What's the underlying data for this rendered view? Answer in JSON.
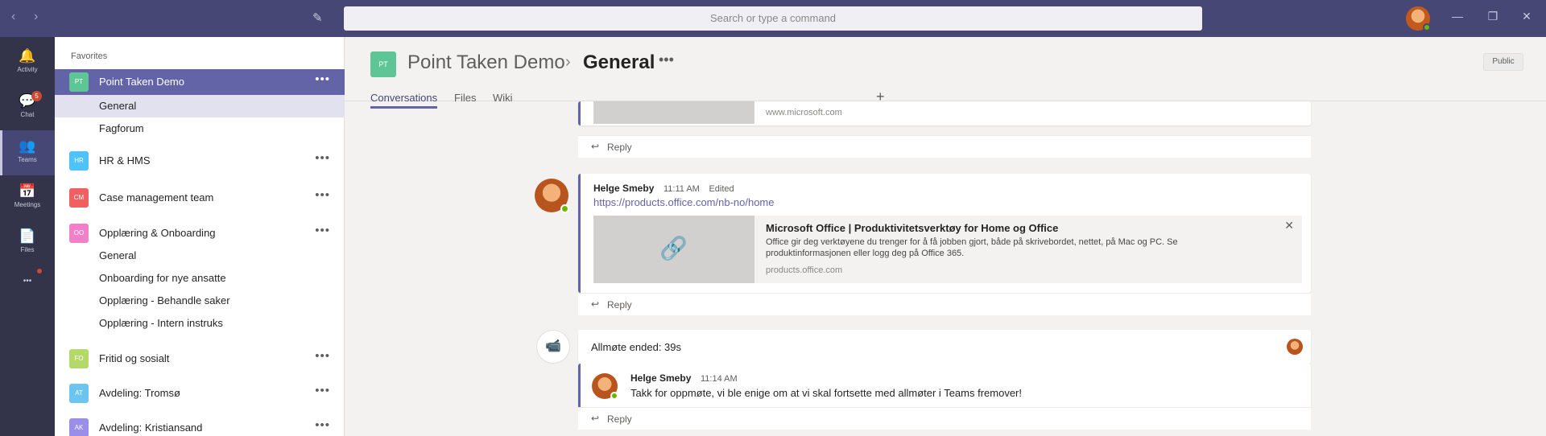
{
  "titlebar": {
    "back_icon": "‹",
    "forward_icon": "›",
    "compose_icon": "✎",
    "search_placeholder": "Search or type a command",
    "minimize_icon": "—",
    "restore_icon": "❐",
    "close_icon": "✕"
  },
  "appbar": {
    "items": [
      {
        "label": "Activity",
        "icon": "🔔"
      },
      {
        "label": "Chat",
        "icon": "💬",
        "badge": "5"
      },
      {
        "label": "Teams",
        "icon": "👥"
      },
      {
        "label": "Meetings",
        "icon": "📅"
      },
      {
        "label": "Files",
        "icon": "📄"
      },
      {
        "label": "",
        "icon": "•••"
      }
    ]
  },
  "sidebar": {
    "favorites_label": "Favorites",
    "teams": [
      {
        "name": "Point Taken Demo",
        "initials": "PT",
        "color": "#5ec596"
      },
      {
        "name": "HR & HMS",
        "initials": "HR",
        "color": "#4fc3f7"
      },
      {
        "name": "Case management team",
        "initials": "CM",
        "color": "#f06060"
      },
      {
        "name": "Opplæring & Onboarding",
        "initials": "OO",
        "color": "#f080c8"
      },
      {
        "name": "Fritid og sosialt",
        "initials": "FO",
        "color": "#b5d86a"
      },
      {
        "name": "Avdeling: Tromsø",
        "initials": "AT",
        "color": "#6cc4f0"
      },
      {
        "name": "Avdeling: Kristiansand",
        "initials": "AK",
        "color": "#9b8ee8"
      }
    ],
    "channels_point_taken": [
      "General",
      "Fagforum"
    ],
    "channels_onboarding": [
      "General",
      "Onboarding for nye ansatte",
      "Opplæring - Behandle saker",
      "Opplæring - Intern instruks"
    ],
    "more_icon": "•••"
  },
  "header": {
    "team": "Point Taken Demo",
    "separator": "›",
    "channel": "General",
    "more": "•••",
    "public_label": "Public",
    "tabs": [
      "Conversations",
      "Files",
      "Wiki"
    ],
    "add_tab": "+"
  },
  "messages": {
    "reply_label": "Reply",
    "reply_icon": "↩",
    "top_link_site": "www.microsoft.com",
    "post": {
      "author": "Helge Smeby",
      "time": "11:11 AM",
      "edited": "Edited",
      "url": "https://products.office.com/nb-no/home",
      "preview_title": "Microsoft Office | Produktivitetsverktøy for Home og Office",
      "preview_desc": "Office gir deg verktøyene du trenger for å få jobben gjort, både på skrivebordet, nettet, på Mac og PC. Se produktinformasjonen eller logg deg på Office 365.",
      "preview_site": "products.office.com",
      "preview_close": "✕",
      "thumb_icon": "🔗"
    },
    "meeting": {
      "icon": "📹",
      "title": "Allmøte ended: 39s",
      "reply_author": "Helge Smeby",
      "reply_time": "11:14 AM",
      "reply_text": "Takk for oppmøte, vi ble enige om at vi skal fortsette med allmøter i Teams fremover!"
    }
  }
}
